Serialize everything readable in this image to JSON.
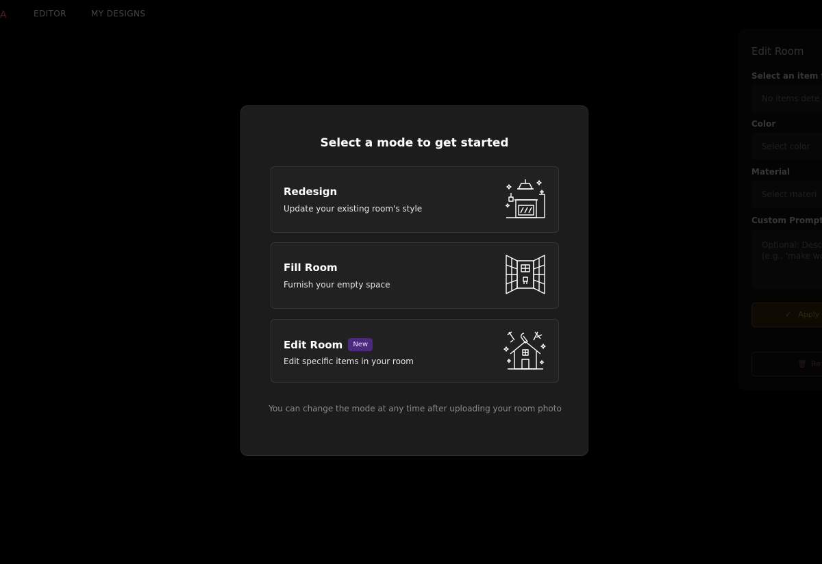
{
  "nav": {
    "logo_fragment": "A",
    "items": [
      "EDITOR",
      "MY DESIGNS"
    ]
  },
  "side_panel": {
    "title": "Edit Room",
    "item_label": "Select an item fr",
    "item_placeholder": "No items dete",
    "color_label": "Color",
    "color_placeholder": "Select color",
    "material_label": "Material",
    "material_placeholder": "Select materi",
    "prompt_label": "Custom Prompt",
    "prompt_placeholder": "Optional: Descr (e.g., 'make wo",
    "apply_label": "Apply",
    "reset_label": "Re"
  },
  "modal": {
    "title": "Select a mode to get started",
    "modes": [
      {
        "title": "Redesign",
        "description": "Update your existing room's style",
        "icon": "kitchen-icon"
      },
      {
        "title": "Fill Room",
        "description": "Furnish your empty space",
        "icon": "empty-room-icon"
      },
      {
        "title": "Edit Room",
        "badge": "New",
        "description": "Edit specific items in your room",
        "icon": "house-tools-icon"
      }
    ],
    "note": "You can change the mode at any time after uploading your room photo"
  },
  "colors": {
    "background": "#000000",
    "modal": "#1c1c1c",
    "card": "#212121",
    "badge": "#4a2a7c",
    "apply": "#2a1e08"
  }
}
